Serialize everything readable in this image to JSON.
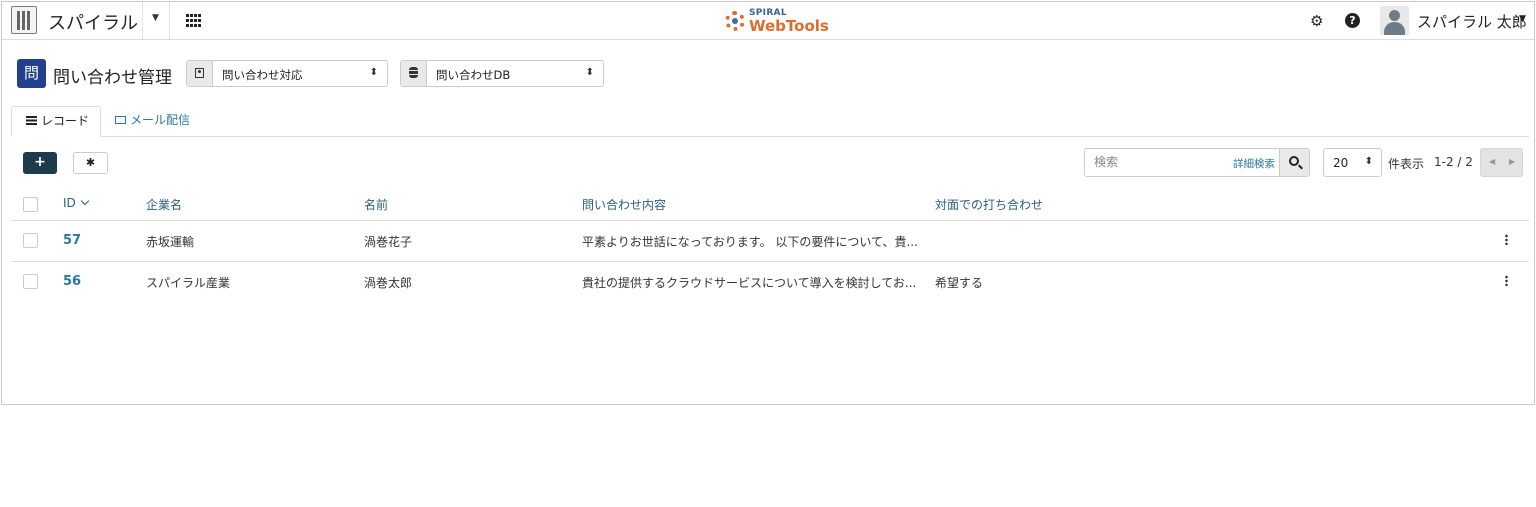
{
  "app": {
    "name": "スパイラル",
    "logo_top": "SPIRAL",
    "logo_bottom": "WebTools"
  },
  "user": {
    "name": "スパイラル 太郎"
  },
  "page": {
    "badge": "問",
    "title": "問い合わせ管理",
    "app_select": "問い合わせ対応",
    "db_select": "問い合わせDB"
  },
  "tabs": [
    {
      "label": "レコード",
      "active": true
    },
    {
      "label": "メール配信",
      "active": false
    }
  ],
  "toolbar": {
    "add_label": "+",
    "search_placeholder": "検索",
    "advanced_search": "詳細検索",
    "per_page": "20",
    "per_page_label": "件表示",
    "count": "1-2 / 2"
  },
  "table": {
    "columns": [
      "ID",
      "企業名",
      "名前",
      "問い合わせ内容",
      "対面での打ち合わせ"
    ],
    "rows": [
      {
        "id": "57",
        "company": "赤坂運輸",
        "name": "渦巻花子",
        "inquiry": "平素よりお世話になっております。 以下の要件について、貴...",
        "meeting": ""
      },
      {
        "id": "56",
        "company": "スパイラル産業",
        "name": "渦巻太郎",
        "inquiry": "貴社の提供するクラウドサービスについて導入を検討してお...",
        "meeting": "希望する"
      }
    ]
  },
  "colors": {
    "primary_dark": "#1e3b4c",
    "badge": "#23408e",
    "link": "#2a7a9c",
    "logo_orange": "#e06b2e"
  },
  "icons": [
    "building-icon",
    "apps-grid-icon",
    "gears-icon",
    "help-icon",
    "user-avatar-icon",
    "person-icon",
    "database-icon",
    "list-icon",
    "mail-icon",
    "gear-icon",
    "search-icon",
    "kebab-icon"
  ]
}
